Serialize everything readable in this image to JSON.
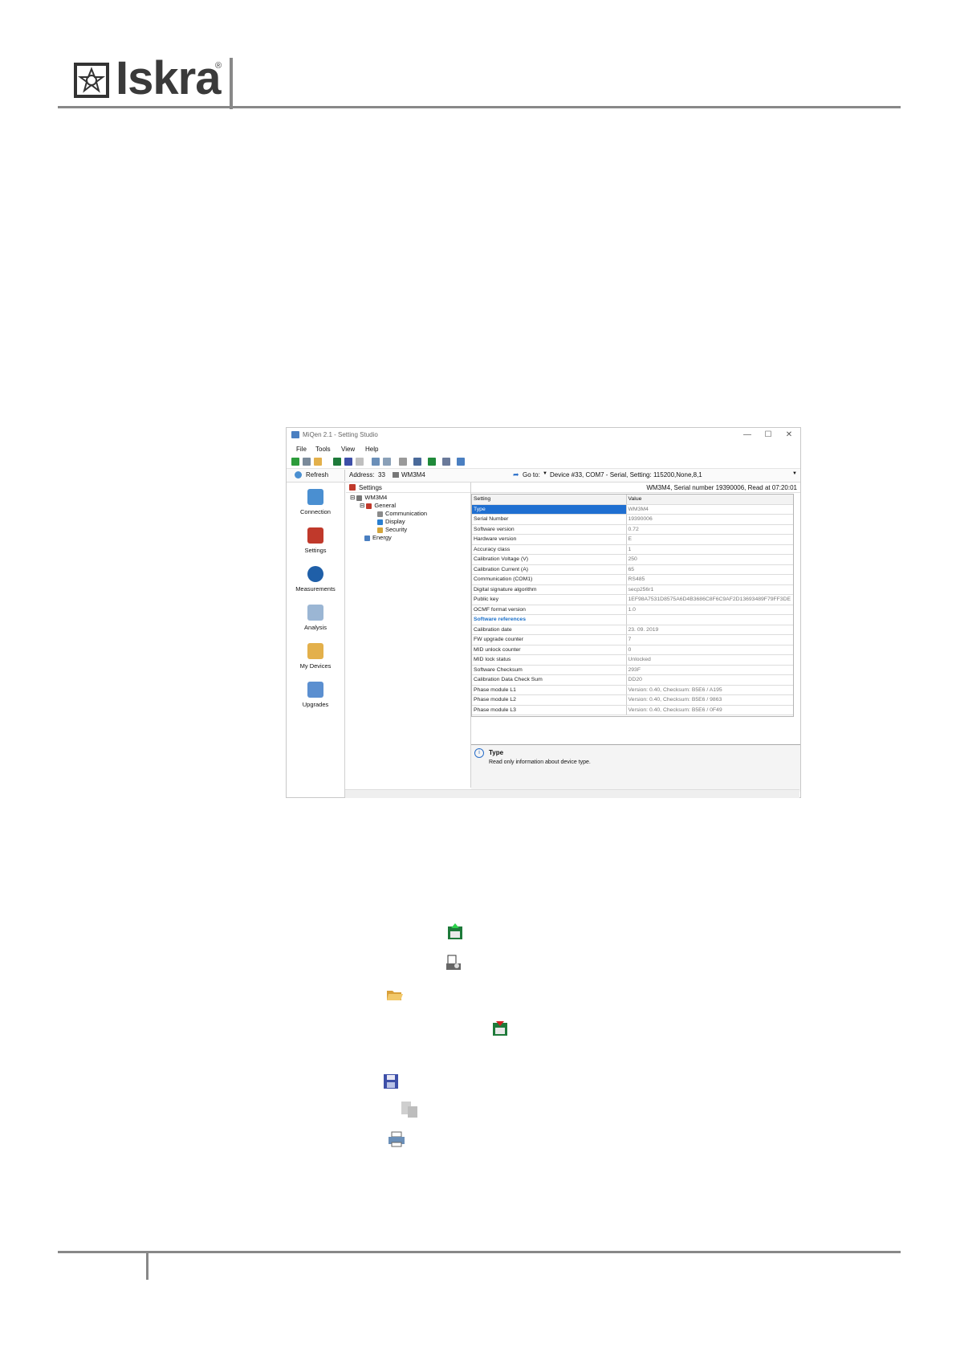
{
  "brand": {
    "name": "Iskra",
    "reg_mark": "®"
  },
  "window": {
    "title": "MiQen 2.1 - Setting Studio",
    "controls": {
      "minimize": "—",
      "maximize": "☐",
      "close": "✕"
    },
    "menu": [
      "File",
      "Tools",
      "View",
      "Help"
    ],
    "refresh_label": "Refresh",
    "address_label": "Address:",
    "address_value": "33",
    "device_model": "WM3M4",
    "goto_label": "Go to:",
    "goto_value": "Device #33, COM7 - Serial, Setting: 115200,None,8,1",
    "sidebar": [
      "Connection",
      "Settings",
      "Measurements",
      "Analysis",
      "My Devices",
      "Upgrades"
    ],
    "tree": {
      "root": "Settings",
      "device": "WM3M4",
      "general": "General",
      "children": [
        "Communication",
        "Display",
        "Security"
      ],
      "energy": "Energy"
    },
    "device_info": "WM3M4, Serial number 19390006, Read at 07:20:01",
    "grid": {
      "headers": [
        "Setting",
        "Value"
      ],
      "rows": [
        {
          "k": "Type",
          "v": "WM3M4"
        },
        {
          "k": "Serial Number",
          "v": "19390006"
        },
        {
          "k": "Software version",
          "v": "0.72"
        },
        {
          "k": "Hardware version",
          "v": "E"
        },
        {
          "k": "Accuracy class",
          "v": "1"
        },
        {
          "k": "Calibration Voltage (V)",
          "v": "250"
        },
        {
          "k": "Calibration Current (A)",
          "v": "65"
        },
        {
          "k": "Communication (COM1)",
          "v": "RS485"
        },
        {
          "k": "Digital signature algorithm",
          "v": "secp256r1"
        },
        {
          "k": "Public key",
          "v": "1EF98A7531D8575A6D4B3686C8F6C9AF2D13693489F79FF3DE"
        },
        {
          "k": "OCMF format version",
          "v": "1.0"
        },
        {
          "k": "Software references",
          "v": ""
        },
        {
          "k": "Calibration date",
          "v": "23. 09. 2019"
        },
        {
          "k": "FW upgrade counter",
          "v": "7"
        },
        {
          "k": "MID unlock counter",
          "v": "0"
        },
        {
          "k": "MID lock status",
          "v": "Unlocked"
        },
        {
          "k": "Software Checksum",
          "v": "293F"
        },
        {
          "k": "Calibration Data Check Sum",
          "v": "DD20"
        },
        {
          "k": "Phase module L1",
          "v": "Version: 0.40, Checksum: B5E6 / A195"
        },
        {
          "k": "Phase module L2",
          "v": "Version: 0.40, Checksum: B5E6 / 9863"
        },
        {
          "k": "Phase module L3",
          "v": "Version: 0.40, Checksum: B5E6 / 0F49"
        }
      ]
    },
    "description": {
      "title": "Type",
      "text": "Read only information about device type."
    }
  },
  "colors": {
    "accent": "#1f6fd1",
    "rule": "#888888"
  },
  "toolbar_icons": [
    "read-settings-icon",
    "print-preview-icon",
    "open-folder-icon",
    "write-settings-icon",
    "save-icon",
    "copy-icon",
    "print-icon"
  ]
}
